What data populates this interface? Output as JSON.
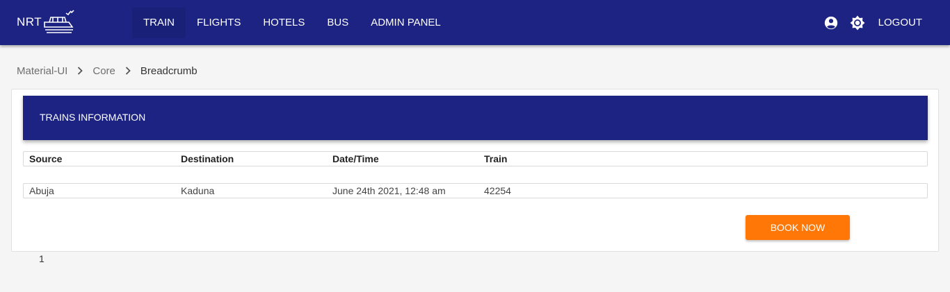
{
  "header": {
    "logo_text": "NRT",
    "nav": [
      {
        "label": "TRAIN",
        "active": true
      },
      {
        "label": "FLIGHTS",
        "active": false
      },
      {
        "label": "HOTELS",
        "active": false
      },
      {
        "label": "BUS",
        "active": false
      },
      {
        "label": "ADMIN PANEL",
        "active": false
      }
    ],
    "icons": [
      "account-circle-icon",
      "brightness-icon"
    ],
    "logout_label": "LOGOUT"
  },
  "breadcrumb": [
    "Material-UI",
    "Core",
    "Breadcrumb"
  ],
  "trains_card": {
    "title": "TRAINS INFORMATION",
    "columns": [
      "Source",
      "Destination",
      "Date/Time",
      "Train"
    ],
    "rows": [
      [
        "Abuja",
        "Kaduna",
        "June 24th 2021, 12:48 am",
        "42254"
      ]
    ],
    "book_label": "BOOK NOW"
  },
  "pagination": {
    "current_page": "1"
  },
  "colors": {
    "primary": "#1c2382",
    "accent": "#ff7707",
    "background": "#f5f5f5"
  }
}
